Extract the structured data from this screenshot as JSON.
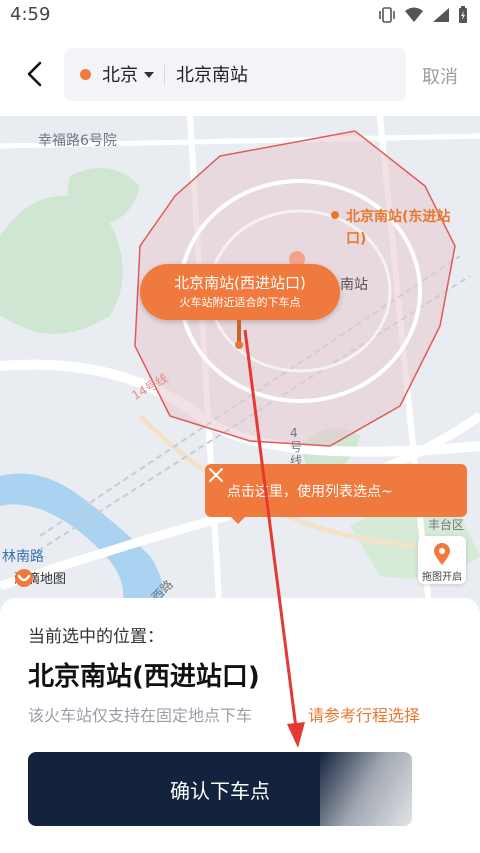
{
  "status_bar": {
    "time": "4:59"
  },
  "search": {
    "city": "北京",
    "query": "北京南站",
    "cancel_label": "取消"
  },
  "map": {
    "street_label": "幸福路6号院",
    "poi_east_entrance": "北京南站(东进站口)",
    "station_label": "南站",
    "line_label_1": "14号线",
    "line_label_2": "4号线",
    "district_label": "丰台区",
    "road_label": "林南路",
    "road_label_2": "西路",
    "logo_text": "滴滴地图",
    "drag_open_label": "拖图开启"
  },
  "pin": {
    "title": "北京南站(西进站口)",
    "subtitle": "火车站附近适合的下车点"
  },
  "tip": {
    "text": "点击这里，使用列表选点~"
  },
  "sheet": {
    "caption": "当前选中的位置：",
    "title": "北京南站(西进站口)",
    "note": "该火车站仅支持在固定地点下车",
    "link": "请参考行程选择",
    "confirm_label": "确认下车点"
  },
  "colors": {
    "accent": "#f07a3e",
    "button": "#14233d",
    "annotation": "#e53935"
  }
}
